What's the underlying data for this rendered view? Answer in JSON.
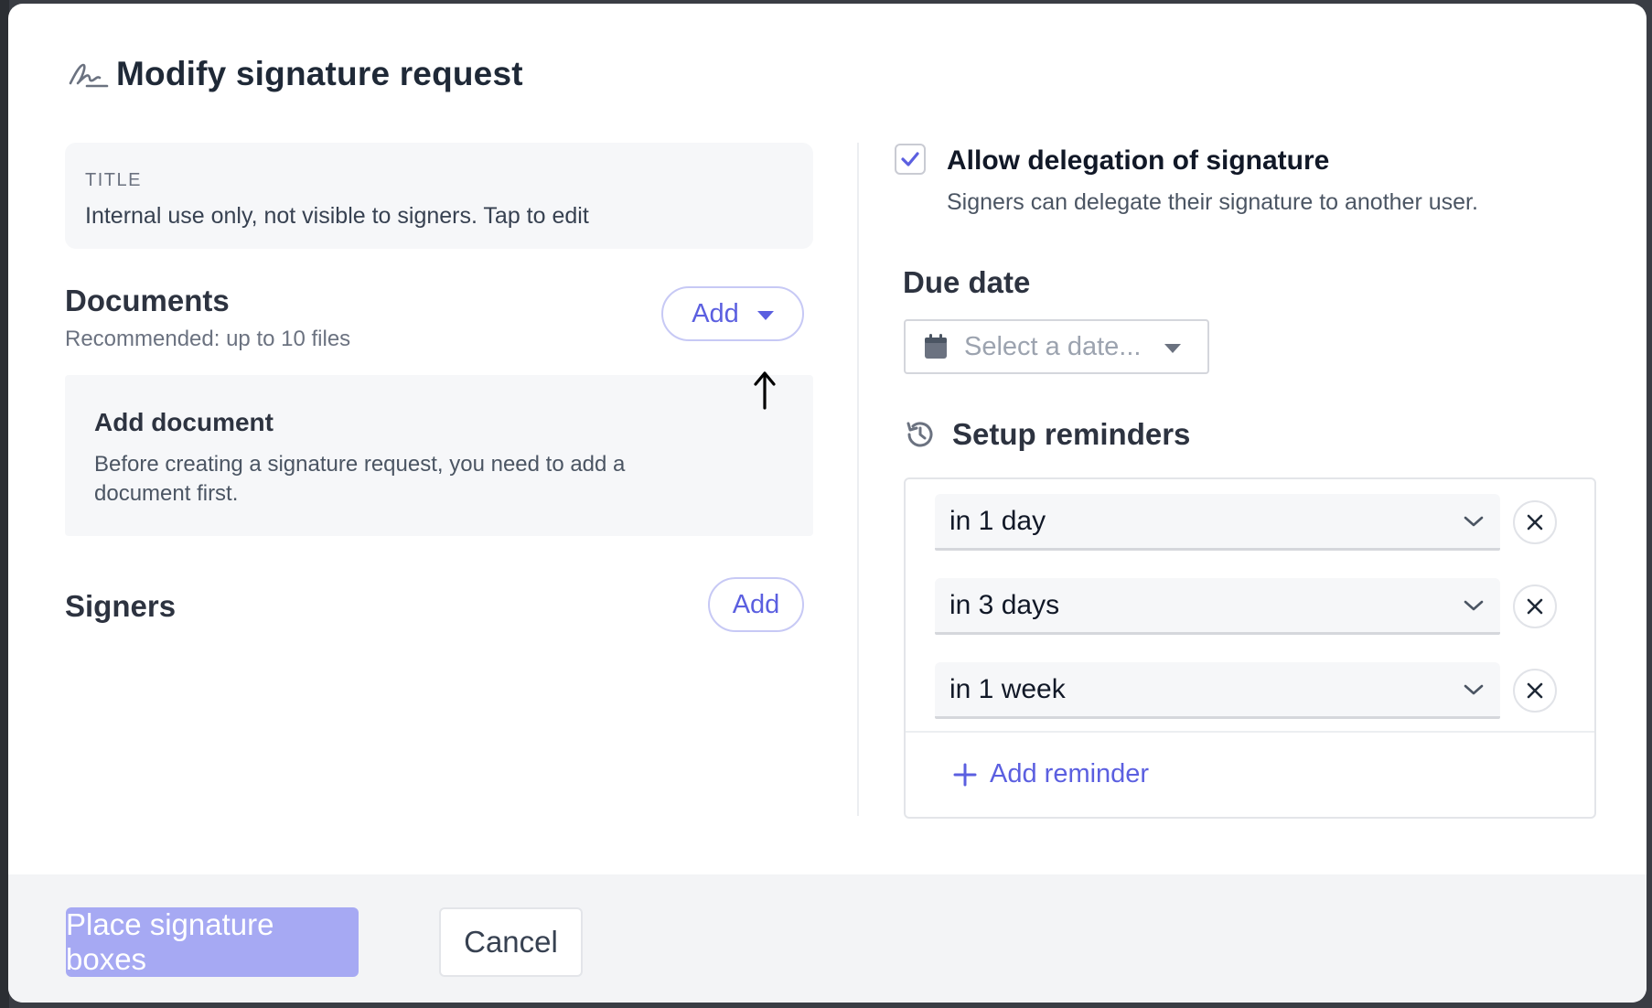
{
  "dialog": {
    "title": "Modify signature request"
  },
  "title_field": {
    "label": "TITLE",
    "placeholder": "Internal use only, not visible to signers. Tap to edit"
  },
  "documents": {
    "heading": "Documents",
    "subtitle": "Recommended: up to 10 files",
    "add_label": "Add",
    "empty_title": "Add document",
    "empty_text": "Before creating a signature request, you need to add a document first."
  },
  "signers": {
    "heading": "Signers",
    "add_label": "Add"
  },
  "delegation": {
    "checked": true,
    "label": "Allow delegation of signature",
    "description": "Signers can delegate their signature to another user."
  },
  "due_date": {
    "heading": "Due date",
    "placeholder": "Select a date..."
  },
  "reminders": {
    "heading": "Setup reminders",
    "items": [
      {
        "value": "in 1 day"
      },
      {
        "value": "in 3 days"
      },
      {
        "value": "in 1 week"
      }
    ],
    "add_label": "Add reminder"
  },
  "footer": {
    "primary_label": "Place signature boxes",
    "cancel_label": "Cancel"
  },
  "colors": {
    "accent": "#5b5fe0",
    "primary_disabled": "#a6a9f3",
    "panel_bg": "#f6f7f9",
    "footer_bg": "#f3f4f6"
  }
}
